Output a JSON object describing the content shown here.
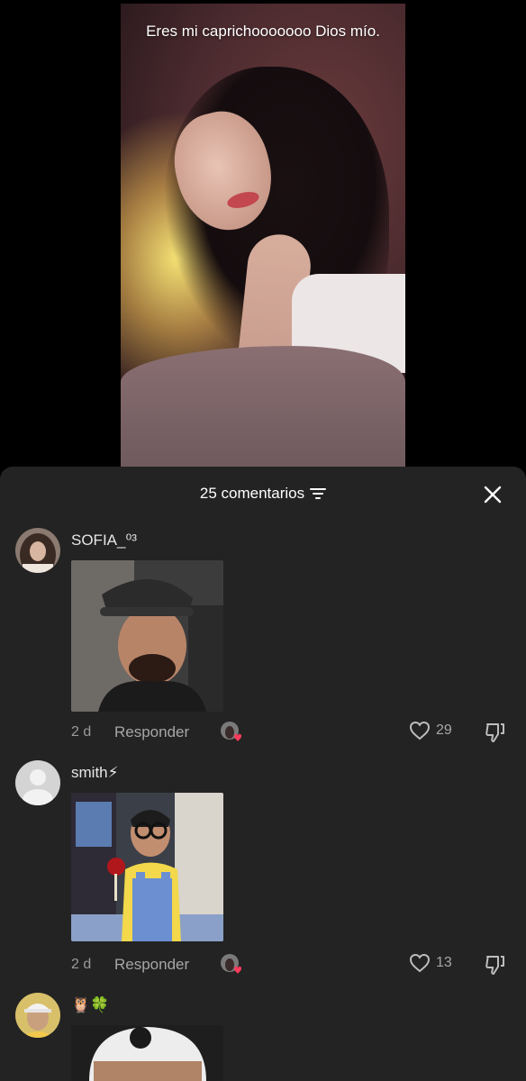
{
  "video": {
    "caption": "Eres mi caprichooooooo Dios mío."
  },
  "comments_sheet": {
    "title": "25 comentarios",
    "filter_icon": "filter-lines-icon",
    "close_icon": "close-icon"
  },
  "comments": [
    {
      "username": "SOFIA_⁰³",
      "time": "2 d",
      "reply_label": "Responder",
      "likes": "29",
      "has_photo": true
    },
    {
      "username": "smith⚡",
      "time": "2 d",
      "reply_label": "Responder",
      "likes": "13",
      "has_photo": true
    },
    {
      "username": "🦉🍀",
      "has_photo": true
    }
  ],
  "colors": {
    "sheet_bg": "#232323",
    "like_heart": "#ff3b5c",
    "secondary_text": "#a6a6a6"
  }
}
